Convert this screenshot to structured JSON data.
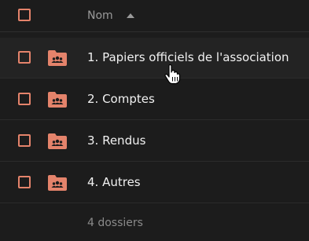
{
  "header": {
    "column_label": "Nom",
    "sort_icon": "sort-ascending-icon"
  },
  "folders": [
    {
      "label": "1. Papiers officiels de l'association",
      "icon": "shared-folder-icon"
    },
    {
      "label": "2. Comptes",
      "icon": "shared-folder-icon"
    },
    {
      "label": "3. Rendus",
      "icon": "shared-folder-icon"
    },
    {
      "label": "4. Autres",
      "icon": "shared-folder-icon"
    }
  ],
  "footer": {
    "count_text": "4 dossiers"
  },
  "colors": {
    "accent": "#e4836b",
    "background": "#1c1c1c",
    "text": "#f1f1f1",
    "muted": "#9a9a9a"
  }
}
